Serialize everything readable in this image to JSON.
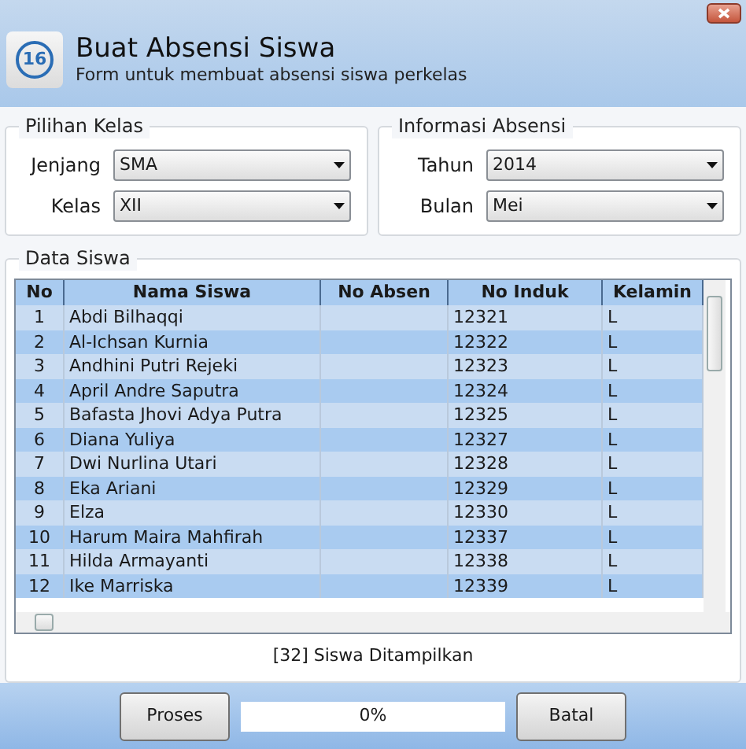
{
  "header": {
    "icon_text": "16",
    "title": "Buat Absensi Siswa",
    "subtitle": "Form untuk membuat absensi siswa perkelas"
  },
  "groups": [
    {
      "title": "Pilihan Kelas",
      "fields": [
        {
          "label": "Jenjang",
          "value": "SMA"
        },
        {
          "label": "Kelas",
          "value": "XII"
        }
      ]
    },
    {
      "title": "Informasi Absensi",
      "fields": [
        {
          "label": "Tahun",
          "value": "2014"
        },
        {
          "label": "Bulan",
          "value": "Mei"
        }
      ]
    }
  ],
  "data": {
    "title": "Data Siswa",
    "table": {
      "columns": [
        "No",
        "Nama Siswa",
        "No Absen",
        "No Induk",
        "Kelamin"
      ],
      "rows": [
        [
          "1",
          "Abdi Bilhaqqi",
          "",
          "12321",
          "L"
        ],
        [
          "2",
          "Al-Ichsan Kurnia",
          "",
          "12322",
          "L"
        ],
        [
          "3",
          "Andhini Putri Rejeki",
          "",
          "12323",
          "L"
        ],
        [
          "4",
          "April Andre Saputra",
          "",
          "12324",
          "L"
        ],
        [
          "5",
          "Bafasta Jhovi Adya Putra",
          "",
          "12325",
          "L"
        ],
        [
          "6",
          "Diana Yuliya",
          "",
          "12327",
          "L"
        ],
        [
          "7",
          "Dwi Nurlina Utari",
          "",
          "12328",
          "L"
        ],
        [
          "8",
          "Eka Ariani",
          "",
          "12329",
          "L"
        ],
        [
          "9",
          "Elza",
          "",
          "12330",
          "L"
        ],
        [
          "10",
          "Harum Maira Mahfirah",
          "",
          "12337",
          "L"
        ],
        [
          "11",
          "Hilda Armayanti",
          "",
          "12338",
          "L"
        ],
        [
          "12",
          "Ike Marriska",
          "",
          "12339",
          "L"
        ]
      ]
    },
    "count": "[32] Siswa Ditampilkan"
  },
  "footer": {
    "buttons": [
      "Proses",
      "Batal"
    ],
    "progress": {
      "level": 0,
      "reading": "0%"
    }
  }
}
